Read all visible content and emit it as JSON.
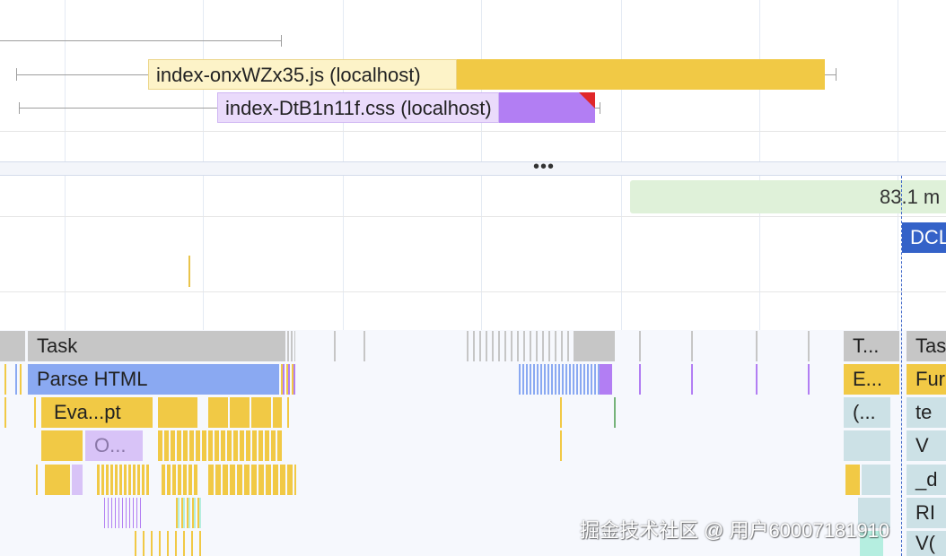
{
  "network": {
    "requests": [
      {
        "label": "index-onxWZx35.js (localhost)"
      },
      {
        "label": "index-DtB1n11f.css (localhost)"
      }
    ]
  },
  "separator": {
    "handle": "•••"
  },
  "timings": {
    "lcp_value": "83.1 m",
    "dcl_marker": "DCL"
  },
  "flame": {
    "row1": {
      "task_main": "Task",
      "task_right_truncated": "T...",
      "task_far_right": "Tas"
    },
    "row2": {
      "parse_html": "Parse HTML",
      "right_e": "E...",
      "far_right": "Fur"
    },
    "row3": {
      "evaluate_script": "Eva...pt",
      "right_paren": "(...",
      "far_right": "te"
    },
    "row4": {
      "o_truncated": "O...",
      "far_right": "V"
    },
    "row5": {
      "far_right": "_d"
    },
    "row6": {
      "far_right": "RI"
    },
    "row7": {
      "far_right": "V("
    }
  },
  "watermark": {
    "text": "掘金技术社区 @ 用户60007181910"
  },
  "colors": {
    "script": "#f1c945",
    "script_light": "#fdf3c8",
    "style": "#b27ef3",
    "style_light": "#eadbfb",
    "task": "#c6c6c6",
    "parse_html": "#8aa9f2",
    "timing_green": "#dff1d9",
    "dcl_blue": "#3462c8",
    "function_teal": "#cce1e6"
  }
}
